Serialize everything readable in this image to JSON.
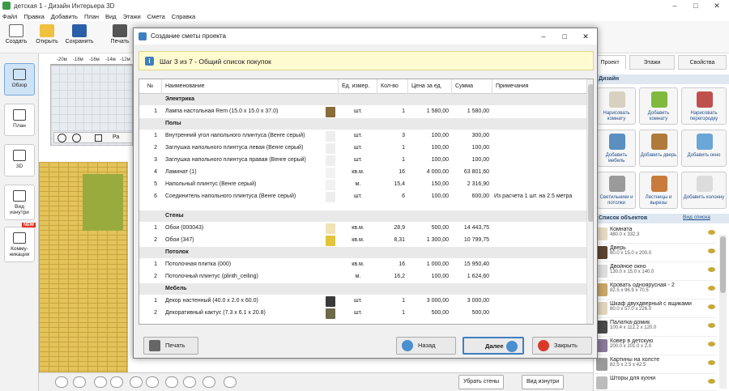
{
  "window": {
    "title": "детская 1 - Дизайн Интерьера 3D"
  },
  "menu": [
    "Файл",
    "Правка",
    "Добавить",
    "План",
    "Вид",
    "Этажи",
    "Смета",
    "Справка"
  ],
  "toolbar": {
    "create": "Создать",
    "open": "Открыть",
    "save": "Сохранить",
    "print": "Печать"
  },
  "left_panel": [
    {
      "label": "Обзор",
      "icon": "overview-icon",
      "active": true
    },
    {
      "label": "План",
      "icon": "plan-icon"
    },
    {
      "label": "3D",
      "icon": "3d-cube-icon"
    },
    {
      "label": "Вид изнутри",
      "icon": "inside-view-icon"
    },
    {
      "label": "Комму-никации",
      "icon": "communications-icon",
      "badge": "NEW"
    }
  ],
  "ruler": [
    "-20м",
    "-18м",
    "-16м",
    "-14м",
    "-12м"
  ],
  "scene_toolbar": {
    "pa": "Ра"
  },
  "bottom_bar": {
    "hide_walls": "Убрать стены",
    "inside_view": "Вид изнутри"
  },
  "right_panel": {
    "tabs": [
      "Проект",
      "Этажи",
      "Свойства"
    ],
    "section_title": "Дизайн",
    "buttons": [
      {
        "label": "Нарисовать комнату"
      },
      {
        "label": "Добавить комнату"
      },
      {
        "label": "Нарисовать перегородку"
      },
      {
        "label": "Добавить мебель"
      },
      {
        "label": "Добавить дверь"
      },
      {
        "label": "Добавить окно"
      },
      {
        "label": "Светильники и потолки"
      },
      {
        "label": "Лестницы и вырезы"
      },
      {
        "label": "Добавить колонну"
      }
    ],
    "objects_title": "Список объектов",
    "view_list": "Вид списка",
    "objects": [
      {
        "name": "Комната",
        "dims": "480.0 x 332.3"
      },
      {
        "name": "Дверь",
        "dims": "80.0 x 15.0 x 200.0"
      },
      {
        "name": "Двойное окно",
        "dims": "130.0 x 15.0 x 140.0"
      },
      {
        "name": "Кровать одноярусная - 2",
        "dims": "82.5 x 96.9 x 70.5"
      },
      {
        "name": "Шкаф двухдверный с ящиками",
        "dims": "80.0 x 57.0 x 226.0"
      },
      {
        "name": "Палатка-домик",
        "dims": "100.4 x 112.2 x 120.0"
      },
      {
        "name": "Ковер в детскую",
        "dims": "200.0 x 201.0 x 2.0"
      },
      {
        "name": "Картины на холсте",
        "dims": "82.5 x 2.5 x 42.5"
      },
      {
        "name": "Шторы для кухни",
        "dims": ""
      }
    ]
  },
  "dialog": {
    "title": "Создание сметы проекта",
    "step": "Шаг 3 из 7 - Общий список покупок",
    "columns": [
      "№",
      "Наименование",
      "Ед. измер.",
      "Кол-во",
      "Цена за ед.",
      "Сумма",
      "Примечания"
    ],
    "rows": [
      {
        "type": "cat",
        "name": "Электрика"
      },
      {
        "type": "item",
        "n": "1",
        "name": "Лампа настольная Rem (15.0 x 15.0 x 37.0)",
        "unit": "шт.",
        "qty": "1",
        "price": "1 580,00",
        "sum": "1 580,00",
        "note": "",
        "swatch": "#8a6b3b"
      },
      {
        "type": "cat",
        "name": "Полы"
      },
      {
        "type": "item",
        "n": "1",
        "name": "Внутренний угол напольного плинтуса (Венге серый)",
        "unit": "шт.",
        "qty": "3",
        "price": "100,00",
        "sum": "300,00",
        "note": "",
        "swatch": "#eeeeee"
      },
      {
        "type": "item",
        "n": "2",
        "name": "Заглушка напольного плинтуса левая (Венге серый)",
        "unit": "шт.",
        "qty": "1",
        "price": "100,00",
        "sum": "100,00",
        "note": "",
        "swatch": "#eeeeee"
      },
      {
        "type": "item",
        "n": "3",
        "name": "Заглушка напольного плинтуса правая (Венге серый)",
        "unit": "шт.",
        "qty": "1",
        "price": "100,00",
        "sum": "100,00",
        "note": "",
        "swatch": "#eeeeee"
      },
      {
        "type": "item",
        "n": "4",
        "name": "Ламинат (1)",
        "unit": "кв.м.",
        "qty": "16",
        "price": "4 000,00",
        "sum": "63 801,60",
        "note": "",
        "swatch": "#f2f2f2"
      },
      {
        "type": "item",
        "n": "5",
        "name": "Напольный плинтус (Венге серый)",
        "unit": "м.",
        "qty": "15,4",
        "price": "150,00",
        "sum": "2 316,90",
        "note": "",
        "swatch": "#f2f2f2"
      },
      {
        "type": "item",
        "n": "6",
        "name": "Соединитель напольного плинтуса (Венге серый)",
        "unit": "шт.",
        "qty": "6",
        "price": "100,00",
        "sum": "600,00",
        "note": "Из расчета 1 шт. на 2.5 метра",
        "swatch": "#eeeeee",
        "tall": true
      },
      {
        "type": "cat",
        "name": "Стены"
      },
      {
        "type": "item",
        "n": "1",
        "name": "Обои (000043)",
        "unit": "кв.м.",
        "qty": "28,9",
        "price": "500,00",
        "sum": "14 443,75",
        "note": "",
        "swatch": "#f3e3b5"
      },
      {
        "type": "item",
        "n": "2",
        "name": "Обои (347)",
        "unit": "кв.м.",
        "qty": "8,31",
        "price": "1 300,00",
        "sum": "10 799,75",
        "note": "",
        "swatch": "#e2c43b"
      },
      {
        "type": "cat",
        "name": "Потолок"
      },
      {
        "type": "item",
        "n": "1",
        "name": "Потолочная плитка (000)",
        "unit": "кв.м.",
        "qty": "16",
        "price": "1 000,00",
        "sum": "15 950,40",
        "note": "",
        "swatch": "#ffffff"
      },
      {
        "type": "item",
        "n": "2",
        "name": "Потолочный плинтус (plinth_ceiling)",
        "unit": "м.",
        "qty": "16,2",
        "price": "100,00",
        "sum": "1 624,60",
        "note": "",
        "swatch": "#ffffff"
      },
      {
        "type": "cat",
        "name": "Мебель"
      },
      {
        "type": "item",
        "n": "1",
        "name": "Декор настенный (40.0 x 2.0 x 60.0)",
        "unit": "шт.",
        "qty": "1",
        "price": "3 000,00",
        "sum": "3 000,00",
        "note": "",
        "swatch": "#3a3a3a"
      },
      {
        "type": "item",
        "n": "2",
        "name": "Декоративный кактус (7.3 x 6.1 x 20.8)",
        "unit": "шт.",
        "qty": "1",
        "price": "500,00",
        "sum": "500,00",
        "note": "",
        "swatch": "#6b6b4b"
      }
    ],
    "buttons": {
      "print": "Печать",
      "back": "Назад",
      "next": "Далее",
      "close": "Закрыть"
    }
  }
}
